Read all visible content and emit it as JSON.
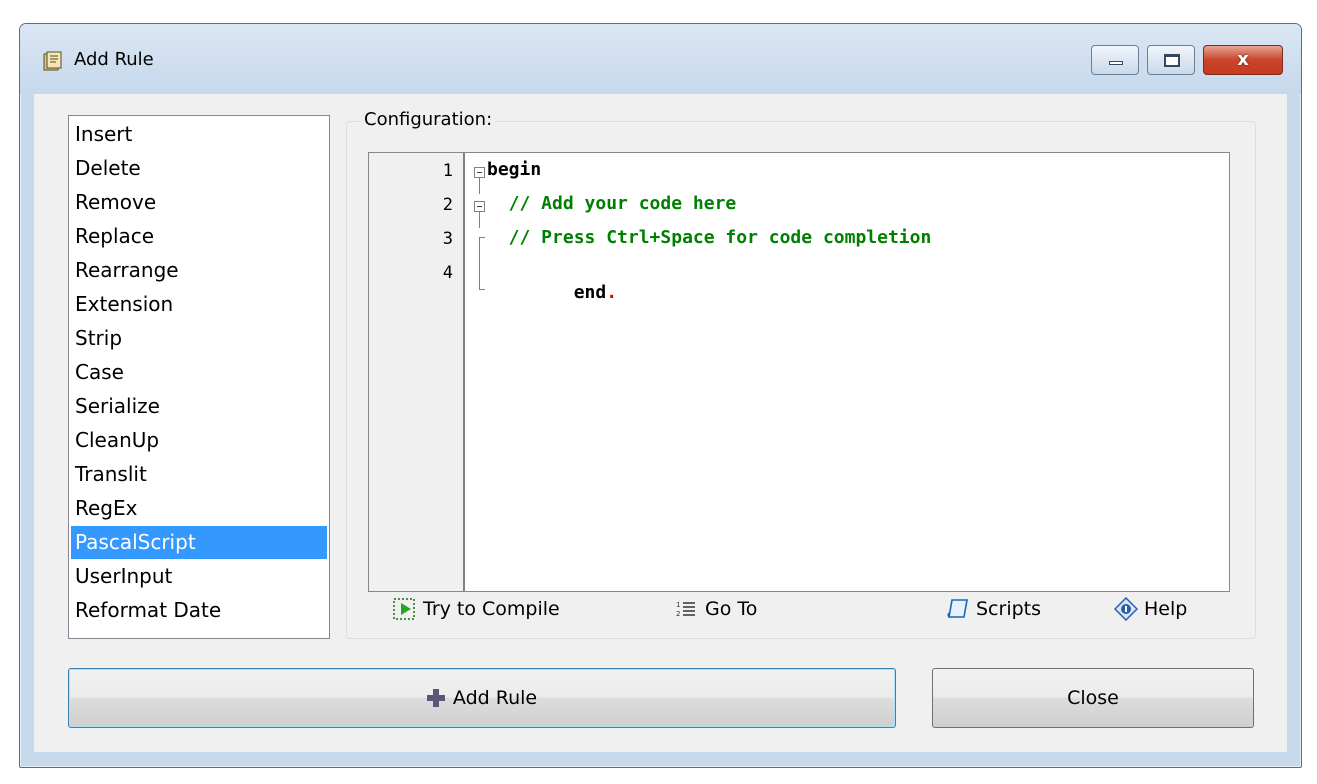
{
  "window": {
    "title": "Add Rule",
    "close_glyph": "x"
  },
  "rules": {
    "items": [
      "Insert",
      "Delete",
      "Remove",
      "Replace",
      "Rearrange",
      "Extension",
      "Strip",
      "Case",
      "Serialize",
      "CleanUp",
      "Translit",
      "RegEx",
      "PascalScript",
      "UserInput",
      "Reformat Date"
    ],
    "selected": "PascalScript"
  },
  "config": {
    "label": "Configuration:",
    "line_numbers": [
      "1",
      "2",
      "3",
      "4"
    ],
    "code": {
      "line1": "begin",
      "line2": "  // Add your code here",
      "line3": "  // Press Ctrl+Space for code completion",
      "line4_kw": "end",
      "line4_dot": "."
    }
  },
  "toolbar": {
    "compile": "Try to Compile",
    "goto": "Go To",
    "scripts": "Scripts",
    "help": "Help"
  },
  "buttons": {
    "add_rule": "Add Rule",
    "close": "Close"
  },
  "colors": {
    "selection": "#3399ff",
    "comment": "#008000",
    "title_bar": "#c7d9ec",
    "close_button": "#c83a1f"
  }
}
